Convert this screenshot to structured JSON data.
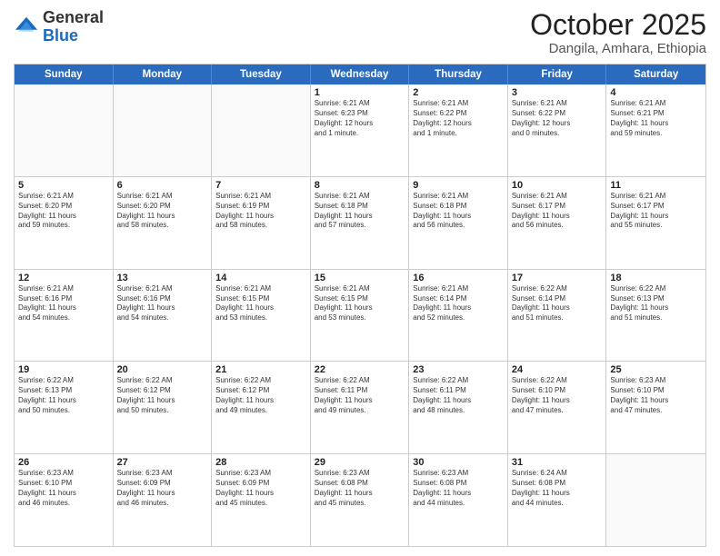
{
  "header": {
    "logo": {
      "general": "General",
      "blue": "Blue"
    },
    "month": "October 2025",
    "location": "Dangila, Amhara, Ethiopia"
  },
  "weekdays": [
    "Sunday",
    "Monday",
    "Tuesday",
    "Wednesday",
    "Thursday",
    "Friday",
    "Saturday"
  ],
  "weeks": [
    [
      {
        "day": "",
        "text": ""
      },
      {
        "day": "",
        "text": ""
      },
      {
        "day": "",
        "text": ""
      },
      {
        "day": "1",
        "text": "Sunrise: 6:21 AM\nSunset: 6:23 PM\nDaylight: 12 hours\nand 1 minute."
      },
      {
        "day": "2",
        "text": "Sunrise: 6:21 AM\nSunset: 6:22 PM\nDaylight: 12 hours\nand 1 minute."
      },
      {
        "day": "3",
        "text": "Sunrise: 6:21 AM\nSunset: 6:22 PM\nDaylight: 12 hours\nand 0 minutes."
      },
      {
        "day": "4",
        "text": "Sunrise: 6:21 AM\nSunset: 6:21 PM\nDaylight: 11 hours\nand 59 minutes."
      }
    ],
    [
      {
        "day": "5",
        "text": "Sunrise: 6:21 AM\nSunset: 6:20 PM\nDaylight: 11 hours\nand 59 minutes."
      },
      {
        "day": "6",
        "text": "Sunrise: 6:21 AM\nSunset: 6:20 PM\nDaylight: 11 hours\nand 58 minutes."
      },
      {
        "day": "7",
        "text": "Sunrise: 6:21 AM\nSunset: 6:19 PM\nDaylight: 11 hours\nand 58 minutes."
      },
      {
        "day": "8",
        "text": "Sunrise: 6:21 AM\nSunset: 6:18 PM\nDaylight: 11 hours\nand 57 minutes."
      },
      {
        "day": "9",
        "text": "Sunrise: 6:21 AM\nSunset: 6:18 PM\nDaylight: 11 hours\nand 56 minutes."
      },
      {
        "day": "10",
        "text": "Sunrise: 6:21 AM\nSunset: 6:17 PM\nDaylight: 11 hours\nand 56 minutes."
      },
      {
        "day": "11",
        "text": "Sunrise: 6:21 AM\nSunset: 6:17 PM\nDaylight: 11 hours\nand 55 minutes."
      }
    ],
    [
      {
        "day": "12",
        "text": "Sunrise: 6:21 AM\nSunset: 6:16 PM\nDaylight: 11 hours\nand 54 minutes."
      },
      {
        "day": "13",
        "text": "Sunrise: 6:21 AM\nSunset: 6:16 PM\nDaylight: 11 hours\nand 54 minutes."
      },
      {
        "day": "14",
        "text": "Sunrise: 6:21 AM\nSunset: 6:15 PM\nDaylight: 11 hours\nand 53 minutes."
      },
      {
        "day": "15",
        "text": "Sunrise: 6:21 AM\nSunset: 6:15 PM\nDaylight: 11 hours\nand 53 minutes."
      },
      {
        "day": "16",
        "text": "Sunrise: 6:21 AM\nSunset: 6:14 PM\nDaylight: 11 hours\nand 52 minutes."
      },
      {
        "day": "17",
        "text": "Sunrise: 6:22 AM\nSunset: 6:14 PM\nDaylight: 11 hours\nand 51 minutes."
      },
      {
        "day": "18",
        "text": "Sunrise: 6:22 AM\nSunset: 6:13 PM\nDaylight: 11 hours\nand 51 minutes."
      }
    ],
    [
      {
        "day": "19",
        "text": "Sunrise: 6:22 AM\nSunset: 6:13 PM\nDaylight: 11 hours\nand 50 minutes."
      },
      {
        "day": "20",
        "text": "Sunrise: 6:22 AM\nSunset: 6:12 PM\nDaylight: 11 hours\nand 50 minutes."
      },
      {
        "day": "21",
        "text": "Sunrise: 6:22 AM\nSunset: 6:12 PM\nDaylight: 11 hours\nand 49 minutes."
      },
      {
        "day": "22",
        "text": "Sunrise: 6:22 AM\nSunset: 6:11 PM\nDaylight: 11 hours\nand 49 minutes."
      },
      {
        "day": "23",
        "text": "Sunrise: 6:22 AM\nSunset: 6:11 PM\nDaylight: 11 hours\nand 48 minutes."
      },
      {
        "day": "24",
        "text": "Sunrise: 6:22 AM\nSunset: 6:10 PM\nDaylight: 11 hours\nand 47 minutes."
      },
      {
        "day": "25",
        "text": "Sunrise: 6:23 AM\nSunset: 6:10 PM\nDaylight: 11 hours\nand 47 minutes."
      }
    ],
    [
      {
        "day": "26",
        "text": "Sunrise: 6:23 AM\nSunset: 6:10 PM\nDaylight: 11 hours\nand 46 minutes."
      },
      {
        "day": "27",
        "text": "Sunrise: 6:23 AM\nSunset: 6:09 PM\nDaylight: 11 hours\nand 46 minutes."
      },
      {
        "day": "28",
        "text": "Sunrise: 6:23 AM\nSunset: 6:09 PM\nDaylight: 11 hours\nand 45 minutes."
      },
      {
        "day": "29",
        "text": "Sunrise: 6:23 AM\nSunset: 6:08 PM\nDaylight: 11 hours\nand 45 minutes."
      },
      {
        "day": "30",
        "text": "Sunrise: 6:23 AM\nSunset: 6:08 PM\nDaylight: 11 hours\nand 44 minutes."
      },
      {
        "day": "31",
        "text": "Sunrise: 6:24 AM\nSunset: 6:08 PM\nDaylight: 11 hours\nand 44 minutes."
      },
      {
        "day": "",
        "text": ""
      }
    ]
  ]
}
